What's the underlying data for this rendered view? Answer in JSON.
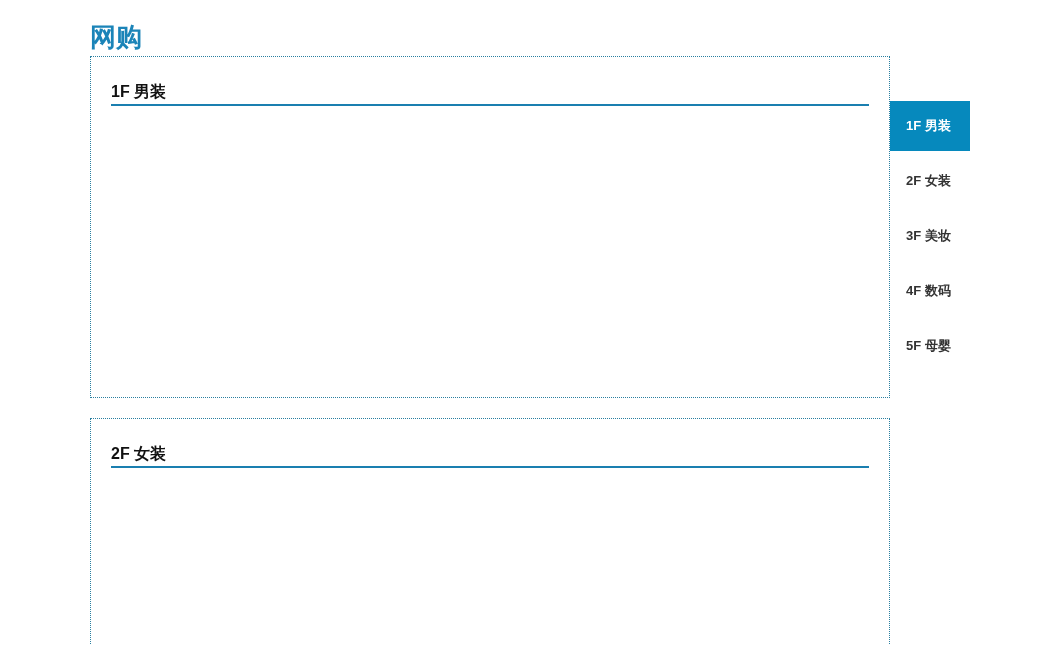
{
  "page_title": "网购",
  "floors": [
    {
      "heading": "1F 男装"
    },
    {
      "heading": "2F 女装"
    }
  ],
  "floor_nav": [
    {
      "label": "1F 男装",
      "selected": true
    },
    {
      "label": "2F 女装",
      "selected": false
    },
    {
      "label": "3F 美妆",
      "selected": false
    },
    {
      "label": "4F 数码",
      "selected": false
    },
    {
      "label": "5F 母婴",
      "selected": false
    }
  ]
}
